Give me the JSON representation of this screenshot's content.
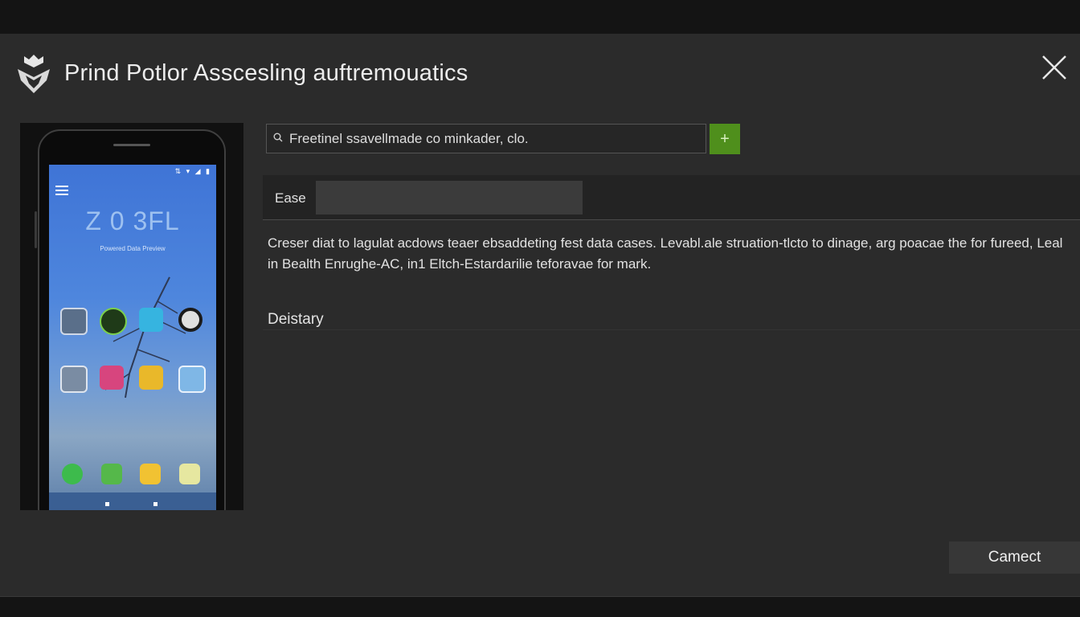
{
  "window": {
    "title": "Prind Potlor Asscesling auftremouatics",
    "close_icon": "close-icon",
    "logo_icon": "shield-logo-icon"
  },
  "phone_preview": {
    "status_icons": "⇅ ▾ ◢ ▮",
    "clock": "Z 0 3FL",
    "date_line": "Powered Data Preview",
    "menu_icon": "hamburger-icon",
    "apps": [
      "gallery-app-icon",
      "green-app-icon",
      "blue-app-icon",
      "compass-app-icon",
      "files-app-icon",
      "pink-app-icon",
      "yellow-app-icon",
      "maps-app-icon"
    ],
    "dock": [
      "phone-app-icon",
      "messages-app-icon",
      "store-app-icon",
      "notes-app-icon"
    ]
  },
  "search": {
    "icon": "search-icon",
    "value": "Freetinel ssavellmade co minkader, clo.",
    "add_label": "+",
    "add_color": "#4f8f1c"
  },
  "ease": {
    "label": "Ease",
    "value": ""
  },
  "description": "Creser diat to lagulat acdows teaer ebsaddeting fest data cases. Levabl.ale struation-tlcto to dinage, arg poacae the for fureed, Leal in Bealth Enrughe-AC, in1 Eltch-Estardarilie teforavae for mark.",
  "section": {
    "title": "Deistary"
  },
  "footer": {
    "cancel_label": "Camect"
  }
}
